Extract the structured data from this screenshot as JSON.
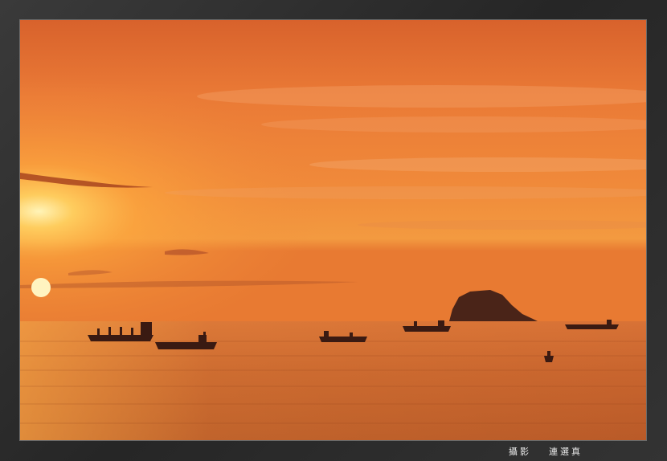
{
  "credit": {
    "label": "攝影",
    "name": "連選真"
  },
  "palette": {
    "frame": "#2e2e2e",
    "sky_top": "#d9602a",
    "sky_mid": "#f08a3a",
    "horizon_glow": "#ffb347",
    "sun": "#fff2b0",
    "sea": "#c8642c",
    "silhouette": "#3a1a12"
  },
  "scene": {
    "subjects": [
      "sun-setting",
      "island-silhouette",
      "cargo-ships",
      "sea",
      "clouds"
    ]
  }
}
